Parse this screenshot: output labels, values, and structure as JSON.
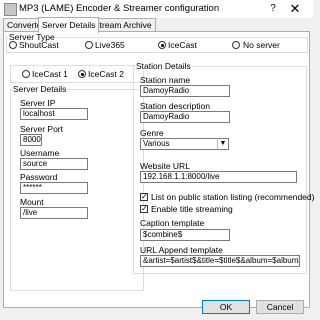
{
  "window": {
    "title": "MP3 (LAME) Encoder & Streamer configuration",
    "help": "?",
    "close": "✕"
  },
  "tabs": [
    "Converter",
    "Server Details",
    "Stream Archive"
  ],
  "server_type": {
    "label": "Server Type",
    "options": [
      "ShoutCast",
      "Live365",
      "IceCast",
      "No server"
    ],
    "selected": "IceCast"
  },
  "icecast_version": {
    "options": [
      "IceCast 1",
      "IceCast 2"
    ],
    "selected": "IceCast 2"
  },
  "server_details": {
    "label": "Server Details",
    "server_ip_label": "Server IP",
    "server_ip": "localhost",
    "server_port_label": "Server Port",
    "server_port": "8000",
    "username_label": "Username",
    "username": "source",
    "password_label": "Password",
    "password": "******",
    "mount_label": "Mount",
    "mount": "/live"
  },
  "station_details": {
    "label": "Station Details",
    "station_name_label": "Station name",
    "station_name": "DamoyRadio",
    "station_desc_label": "Station description",
    "station_desc": "DamoyRadio",
    "genre_label": "Genre",
    "genre": "Various",
    "website_label": "Website URL",
    "website": "192.168.1.1:8000/live",
    "list_public_label": "List on public station listing (recommended)",
    "list_public": true,
    "title_streaming_label": "Enable title streaming",
    "title_streaming": true,
    "caption_label": "Caption template",
    "caption": "$combine$",
    "url_append_label": "URL Append template",
    "url_append": "&artist=$artist$&title=$title$&album=$album$"
  },
  "buttons": {
    "ok": "OK",
    "cancel": "Cancel"
  }
}
